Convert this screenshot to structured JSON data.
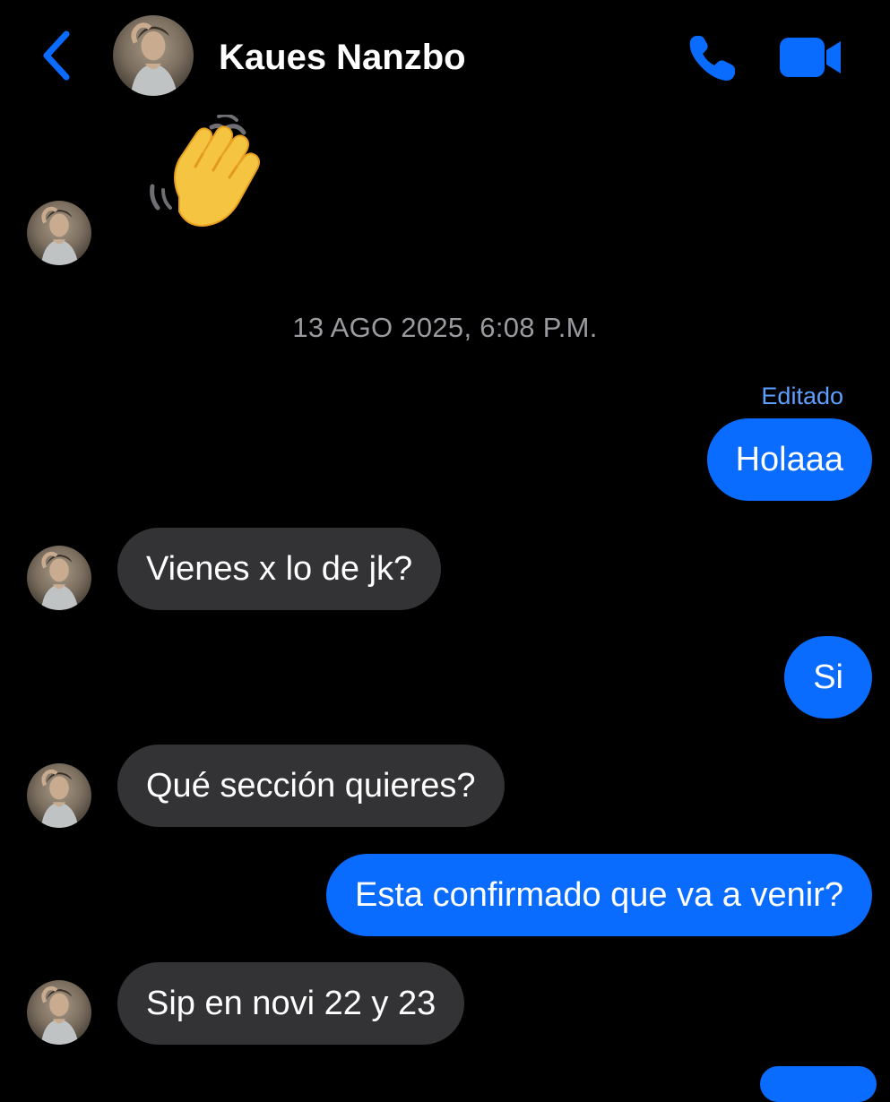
{
  "header": {
    "contact_name": "Kaues Nanzbo",
    "back_icon": "chevron-left-icon",
    "call_icon": "phone-icon",
    "video_icon": "video-camera-icon",
    "accent_color": "#0a6cff"
  },
  "messages": {
    "wave_emoji": "👋",
    "timestamp": "13 AGO 2025, 6:08 P.M.",
    "edited_label": "Editado",
    "m1": "Holaaa",
    "m2": "Viene​s x lo de jk?",
    "m3": "Si",
    "m4": "Qué sección quieres?",
    "m5": "Esta confirmado que va a venir?",
    "m6": "Sip en novi 22 y 23"
  },
  "colors": {
    "background": "#000000",
    "outgoing_bubble": "#0a6cff",
    "incoming_bubble": "#333335",
    "timestamp_text": "#9a9a9f",
    "edited_text": "#5ea0ff"
  }
}
